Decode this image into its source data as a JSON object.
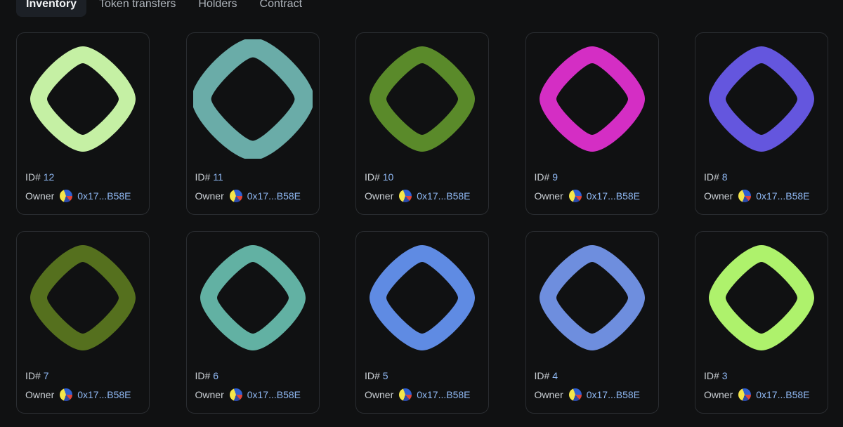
{
  "tabs": [
    {
      "label": "Inventory",
      "active": true
    },
    {
      "label": "Token transfers",
      "active": false
    },
    {
      "label": "Holders",
      "active": false
    },
    {
      "label": "Contract",
      "active": false
    }
  ],
  "labels": {
    "id_prefix": "ID#",
    "owner": "Owner"
  },
  "tokens": [
    {
      "id": "12",
      "owner": "0x17...B58E",
      "color": "#c5f0a4",
      "clipped": false
    },
    {
      "id": "11",
      "owner": "0x17...B58E",
      "color": "#6aaca8",
      "clipped": true
    },
    {
      "id": "10",
      "owner": "0x17...B58E",
      "color": "#5a8a2a",
      "clipped": false
    },
    {
      "id": "9",
      "owner": "0x17...B58E",
      "color": "#d42ec4",
      "clipped": false
    },
    {
      "id": "8",
      "owner": "0x17...B58E",
      "color": "#6456de",
      "clipped": false
    },
    {
      "id": "7",
      "owner": "0x17...B58E",
      "color": "#55701e",
      "clipped": false
    },
    {
      "id": "6",
      "owner": "0x17...B58E",
      "color": "#62b1a3",
      "clipped": false
    },
    {
      "id": "5",
      "owner": "0x17...B58E",
      "color": "#5f8be3",
      "clipped": false
    },
    {
      "id": "4",
      "owner": "0x17...B58E",
      "color": "#6e8ede",
      "clipped": false
    },
    {
      "id": "3",
      "owner": "0x17...B58E",
      "color": "#aef26c",
      "clipped": false
    }
  ]
}
